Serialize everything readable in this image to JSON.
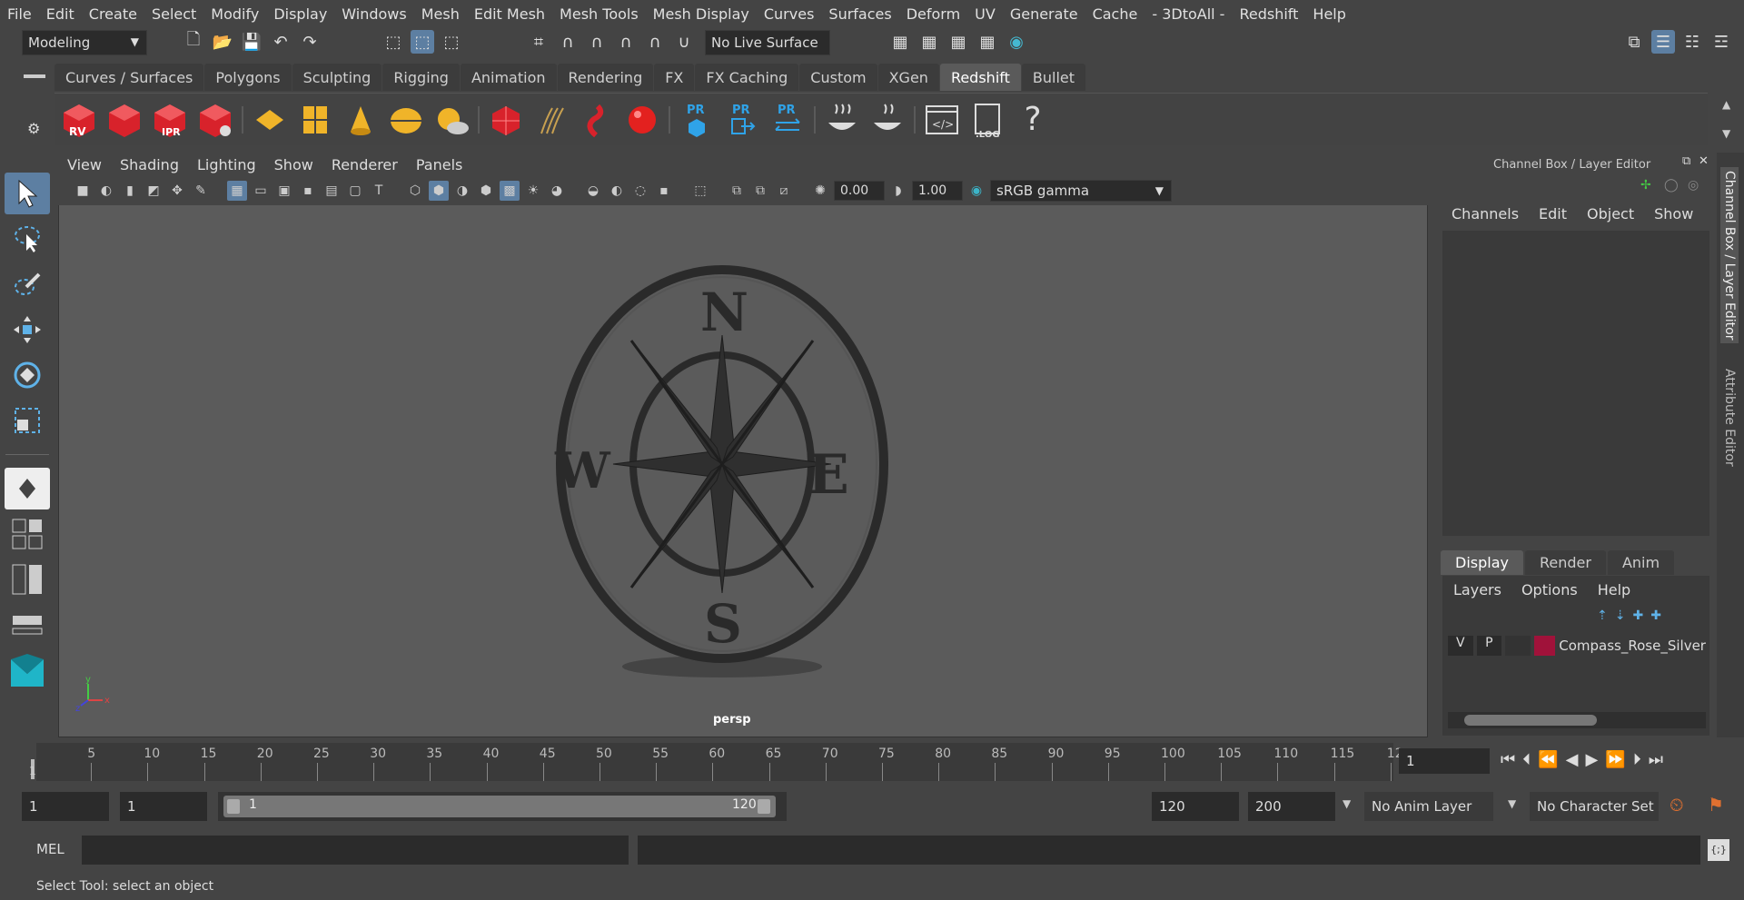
{
  "menu": [
    "File",
    "Edit",
    "Create",
    "Select",
    "Modify",
    "Display",
    "Windows",
    "Mesh",
    "Edit Mesh",
    "Mesh Tools",
    "Mesh Display",
    "Curves",
    "Surfaces",
    "Deform",
    "UV",
    "Generate",
    "Cache",
    "- 3DtoAll -",
    "Redshift",
    "Help"
  ],
  "mode_select": "Modeling",
  "live_surface": "No Live Surface",
  "shelf_tabs": [
    "Curves / Surfaces",
    "Polygons",
    "Sculpting",
    "Rigging",
    "Animation",
    "Rendering",
    "FX",
    "FX Caching",
    "Custom",
    "XGen",
    "Redshift",
    "Bullet"
  ],
  "active_shelf": "Redshift",
  "shelf_labels": {
    "rv": "RV",
    "ipr": "IPR",
    "pr1": "PR",
    "pr2": "PR",
    "pr3": "PR",
    "log": ".LOG",
    "help": "?"
  },
  "viewport_menu": [
    "View",
    "Shading",
    "Lighting",
    "Show",
    "Renderer",
    "Panels"
  ],
  "viewport": {
    "exposure": "0.00",
    "gamma": "1.00",
    "colorspace": "sRGB gamma",
    "camera": "persp",
    "compass_letters": {
      "n": "N",
      "s": "S",
      "e": "E",
      "w": "W"
    }
  },
  "channel_box": {
    "title": "Channel Box / Layer Editor",
    "menu": [
      "Channels",
      "Edit",
      "Object",
      "Show"
    ]
  },
  "layer_editor": {
    "tabs": [
      "Display",
      "Render",
      "Anim"
    ],
    "active_tab": "Display",
    "menu": [
      "Layers",
      "Options",
      "Help"
    ],
    "layer": {
      "v": "V",
      "p": "P",
      "name": "Compass_Rose_Silver",
      "color": "#a0123a"
    }
  },
  "side_tabs": [
    "Channel Box / Layer Editor",
    "Attribute Editor"
  ],
  "timeline": {
    "ticks": [
      "5",
      "10",
      "15",
      "20",
      "25",
      "30",
      "35",
      "40",
      "45",
      "50",
      "55",
      "60",
      "65",
      "70",
      "75",
      "80",
      "85",
      "90",
      "95",
      "100",
      "105",
      "110",
      "115",
      "12"
    ],
    "start_label": "1",
    "current_frame": "1"
  },
  "range": {
    "start": "1",
    "playback_start": "1",
    "slider_start": "1",
    "slider_end": "120",
    "playback_end": "120",
    "end": "200",
    "anim_layer": "No Anim Layer",
    "char_set": "No Character Set"
  },
  "cmd": {
    "label": "MEL"
  },
  "help_text": "Select Tool: select an object",
  "colors": {
    "accent": "#5d7fa2",
    "redshift_red": "#d8222b",
    "gold": "#f0b429"
  }
}
